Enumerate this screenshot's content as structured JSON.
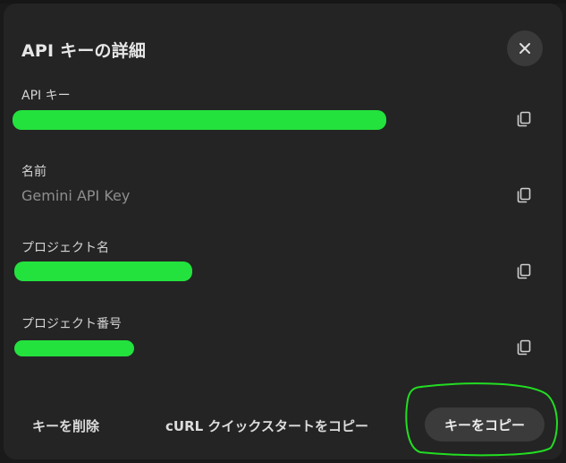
{
  "dialog": {
    "title": "API キーの詳細",
    "close_icon": "close-icon"
  },
  "fields": [
    {
      "label": "API キー",
      "value": "",
      "redacted": true,
      "copy_icon": "copy-icon"
    },
    {
      "label": "名前",
      "value": "Gemini API Key",
      "redacted": false,
      "copy_icon": "copy-icon"
    },
    {
      "label": "プロジェクト名",
      "value": "",
      "redacted": true,
      "copy_icon": "copy-icon"
    },
    {
      "label": "プロジェクト番号",
      "value": "",
      "redacted": true,
      "copy_icon": "copy-icon"
    }
  ],
  "footer": {
    "delete_label": "キーを削除",
    "curl_label": "cURL クイックスタートをコピー",
    "copy_key_label": "キーをコピー"
  },
  "colors": {
    "redaction": "#23e23e",
    "annotation": "#22dd22",
    "dialog_bg": "#242424"
  }
}
